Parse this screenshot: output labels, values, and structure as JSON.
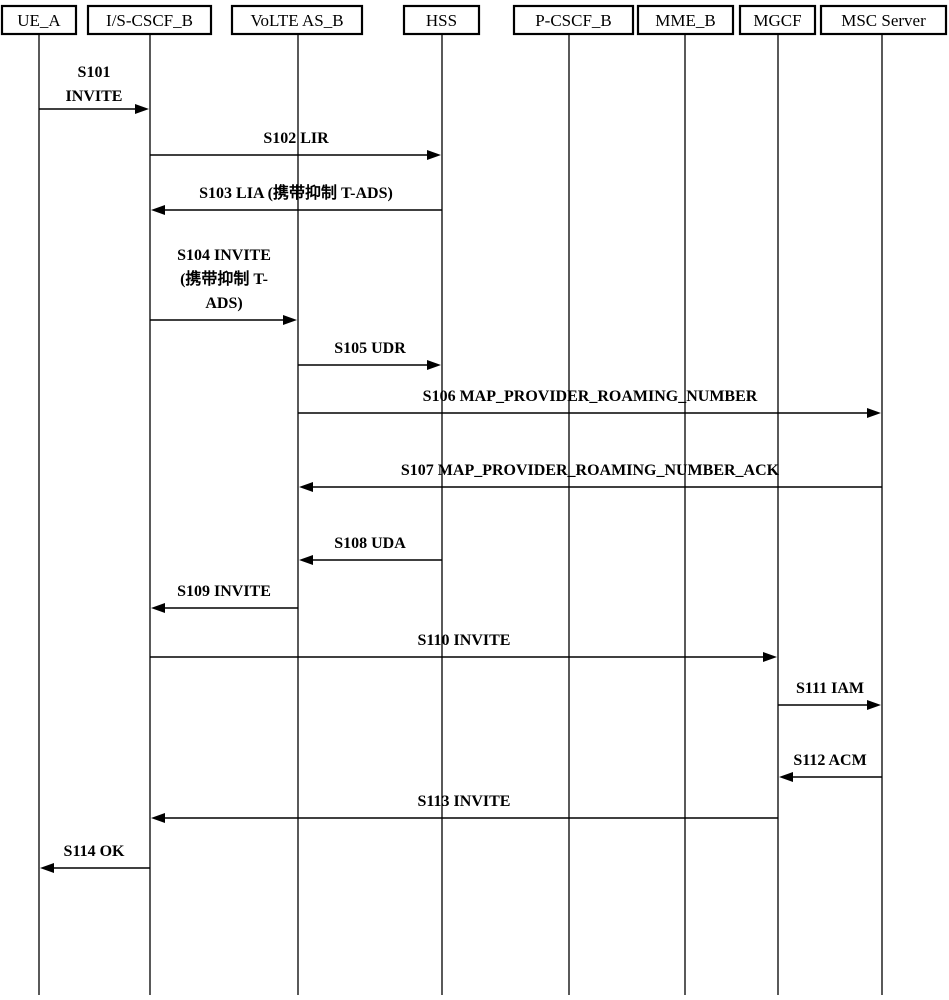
{
  "diagram": {
    "type": "sequence-diagram",
    "participants": [
      {
        "id": "ue_a",
        "label": "UE_A"
      },
      {
        "id": "is_cscf_b",
        "label": "I/S-CSCF_B"
      },
      {
        "id": "volte_as_b",
        "label": "VoLTE AS_B"
      },
      {
        "id": "hss",
        "label": "HSS"
      },
      {
        "id": "p_cscf_b",
        "label": "P-CSCF_B"
      },
      {
        "id": "mme_b",
        "label": "MME_B"
      },
      {
        "id": "mgcf",
        "label": "MGCF"
      },
      {
        "id": "msc_server",
        "label": "MSC Server"
      }
    ],
    "messages": [
      {
        "step": "S101",
        "from": "ue_a",
        "to": "is_cscf_b",
        "label_lines": [
          "S101",
          "INVITE"
        ]
      },
      {
        "step": "S102",
        "from": "is_cscf_b",
        "to": "hss",
        "label_lines": [
          "S102 LIR"
        ]
      },
      {
        "step": "S103",
        "from": "hss",
        "to": "is_cscf_b",
        "label_lines": [
          "S103 LIA (携带抑制 T-ADS)"
        ]
      },
      {
        "step": "S104",
        "from": "is_cscf_b",
        "to": "volte_as_b",
        "label_lines": [
          "S104  INVITE",
          "(携带抑制 T-",
          "ADS)"
        ]
      },
      {
        "step": "S105",
        "from": "volte_as_b",
        "to": "hss",
        "label_lines": [
          "S105 UDR"
        ]
      },
      {
        "step": "S106",
        "from": "volte_as_b",
        "to": "msc_server",
        "label_lines": [
          "S106  MAP_PROVIDER_ROAMING_NUMBER"
        ]
      },
      {
        "step": "S107",
        "from": "msc_server",
        "to": "volte_as_b",
        "label_lines": [
          "S107 MAP_PROVIDER_ROAMING_NUMBER_ACK"
        ]
      },
      {
        "step": "S108",
        "from": "hss",
        "to": "volte_as_b",
        "label_lines": [
          "S108  UDA"
        ]
      },
      {
        "step": "S109",
        "from": "volte_as_b",
        "to": "is_cscf_b",
        "label_lines": [
          "S109  INVITE"
        ]
      },
      {
        "step": "S110",
        "from": "is_cscf_b",
        "to": "mgcf",
        "label_lines": [
          "S110  INVITE"
        ]
      },
      {
        "step": "S111",
        "from": "mgcf",
        "to": "msc_server",
        "label_lines": [
          "S111 IAM"
        ]
      },
      {
        "step": "S112",
        "from": "msc_server",
        "to": "mgcf",
        "label_lines": [
          "S112 ACM"
        ]
      },
      {
        "step": "S113",
        "from": "mgcf",
        "to": "is_cscf_b",
        "label_lines": [
          "S113  INVITE"
        ]
      },
      {
        "step": "S114",
        "from": "is_cscf_b",
        "to": "ue_a",
        "label_lines": [
          "S114  OK"
        ]
      }
    ]
  }
}
